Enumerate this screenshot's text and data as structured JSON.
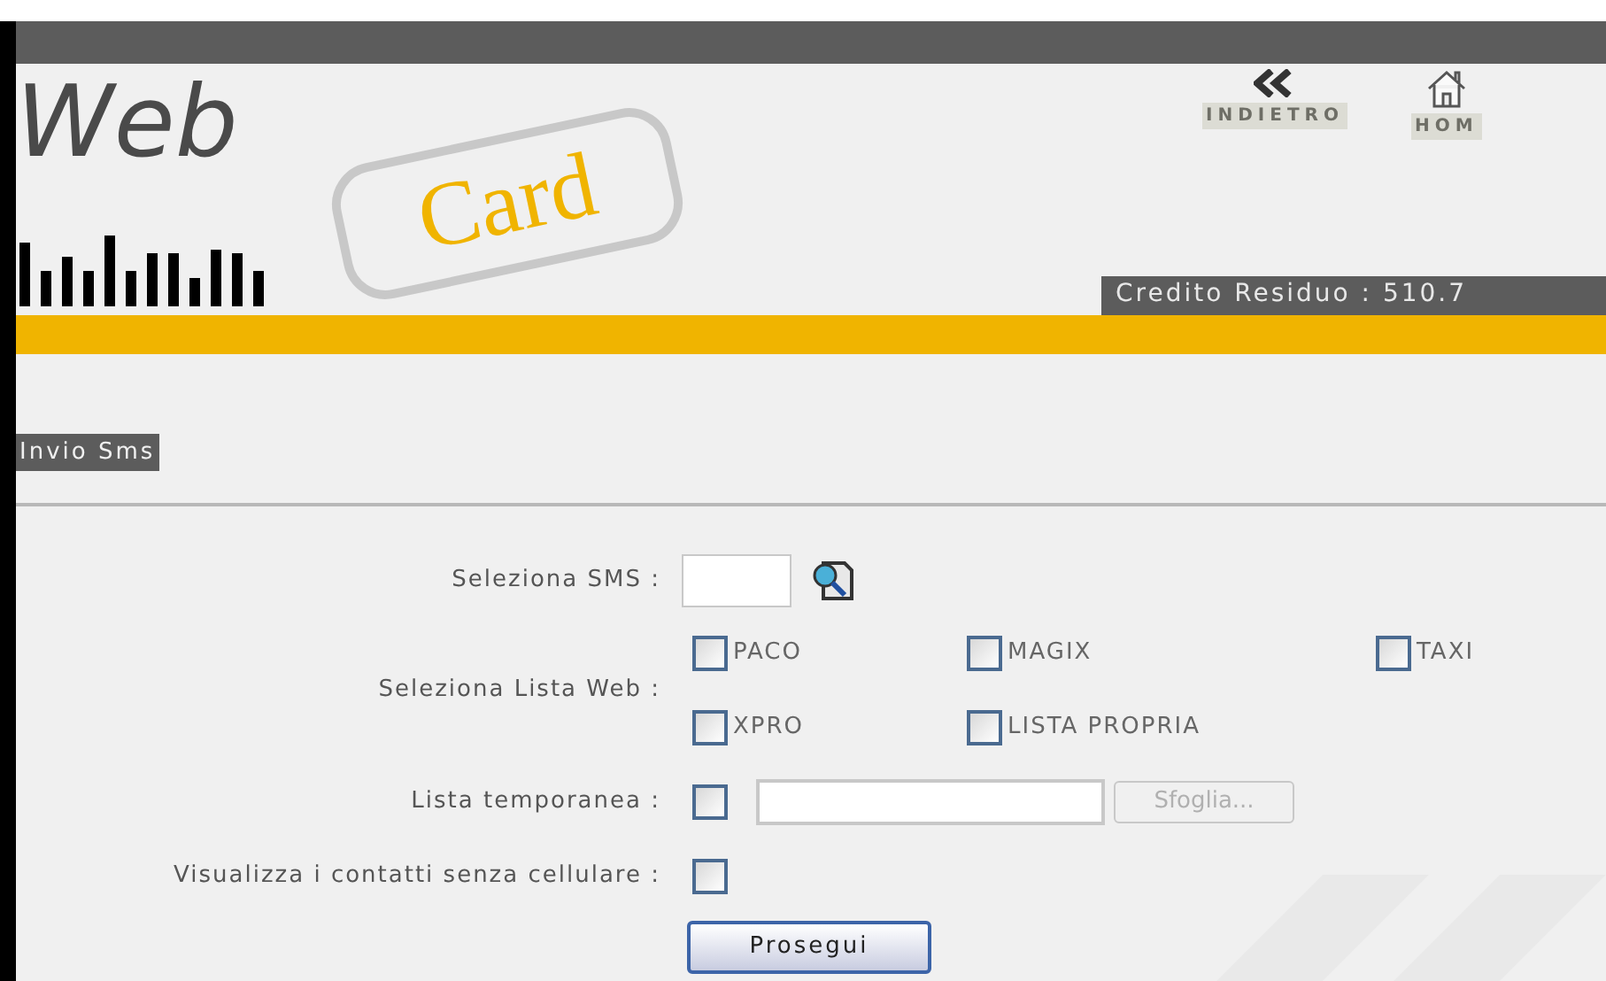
{
  "header": {
    "logo": {
      "word_1": "Web",
      "word_2": "Card"
    },
    "nav": [
      {
        "label": "INDIETRO",
        "kind": "back"
      },
      {
        "label": "HOM",
        "kind": "home"
      }
    ],
    "credit": "Credito Residuo : 510.7"
  },
  "section_title": "Invio Sms",
  "form": {
    "sms": {
      "label": "Seleziona SMS :"
    },
    "lists": {
      "label": "Seleziona Lista Web :",
      "options": [
        {
          "label": "PACO",
          "checked": false
        },
        {
          "label": "MAGIX",
          "checked": false
        },
        {
          "label": "TAXI",
          "checked": false
        },
        {
          "label": "XPRO",
          "checked": false
        },
        {
          "label": "LISTA PROPRIA",
          "checked": false
        }
      ]
    },
    "temp": {
      "label": "Lista temporanea :",
      "checked": false,
      "browse_button": "Sfoglia..."
    },
    "no_mobile": {
      "label": "Visualizza i contatti senza cellulare :",
      "checked": false
    },
    "submit": "Prosegui"
  }
}
